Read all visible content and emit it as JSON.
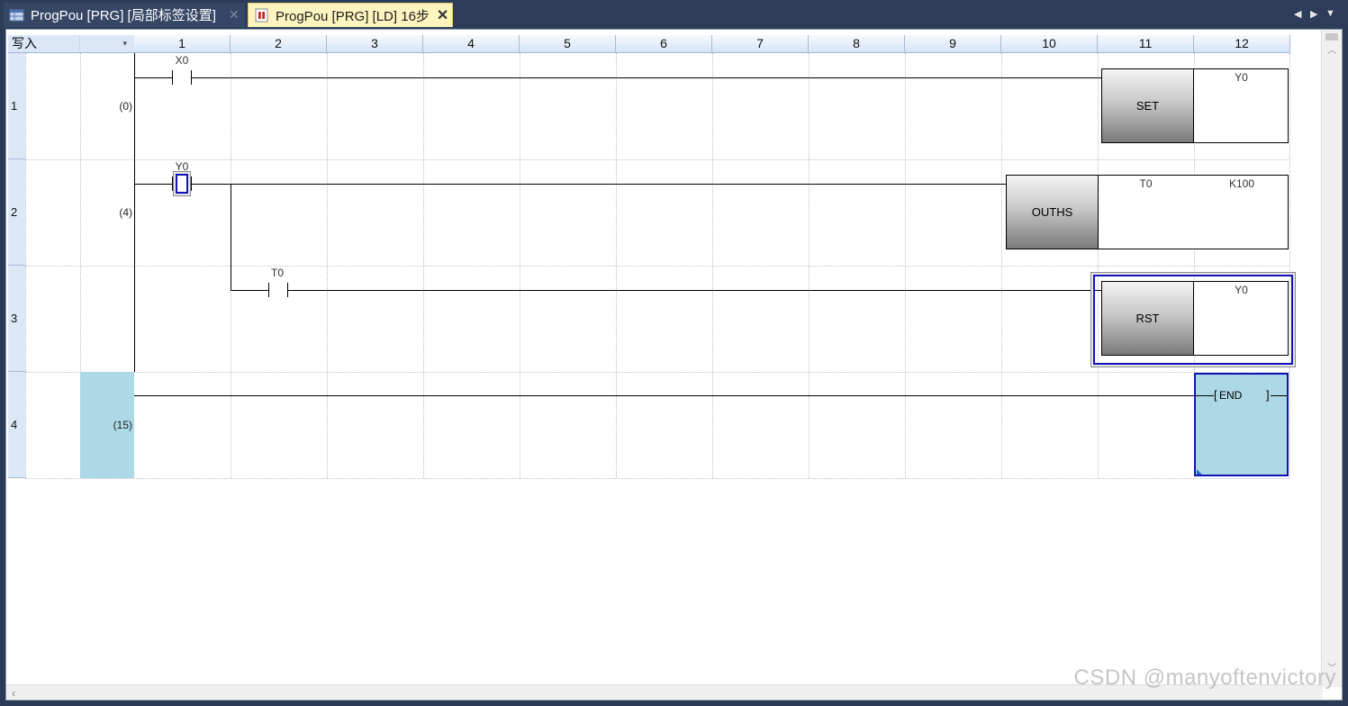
{
  "tabs": [
    {
      "label": "ProgPou [PRG] [局部标签设置]",
      "active": false
    },
    {
      "label": "ProgPou [PRG] [LD] 16步",
      "active": true
    }
  ],
  "tab_controls": {
    "prev": "◀",
    "next": "▶",
    "menu": "▼"
  },
  "editor": {
    "mode_label": "写入",
    "mode_dropdown": "▾",
    "columns": [
      "1",
      "2",
      "3",
      "4",
      "5",
      "6",
      "7",
      "8",
      "9",
      "10",
      "11",
      "12"
    ],
    "rows": [
      {
        "num": "1",
        "step": "(0)"
      },
      {
        "num": "2",
        "step": "(4)"
      },
      {
        "num": "3",
        "step": ""
      },
      {
        "num": "4",
        "step": "(15)"
      }
    ]
  },
  "ladder": {
    "x0_label": "X0",
    "set_instr": "SET",
    "set_operand": "Y0",
    "y0_label": "Y0",
    "ouths_instr": "OUTHS",
    "ouths_op1": "T0",
    "ouths_op2": "K100",
    "t0_label": "T0",
    "rst_instr": "RST",
    "rst_operand": "Y0",
    "end_label": "END",
    "end_bracket_l": "[",
    "end_bracket_r": "]"
  },
  "watermark": "CSDN @manyoftenvictory",
  "colors": {
    "selection": "#1313b8",
    "end_fill": "#add8e6",
    "tab_active": "#fdf4bf",
    "titlebar": "#2d3c59"
  }
}
